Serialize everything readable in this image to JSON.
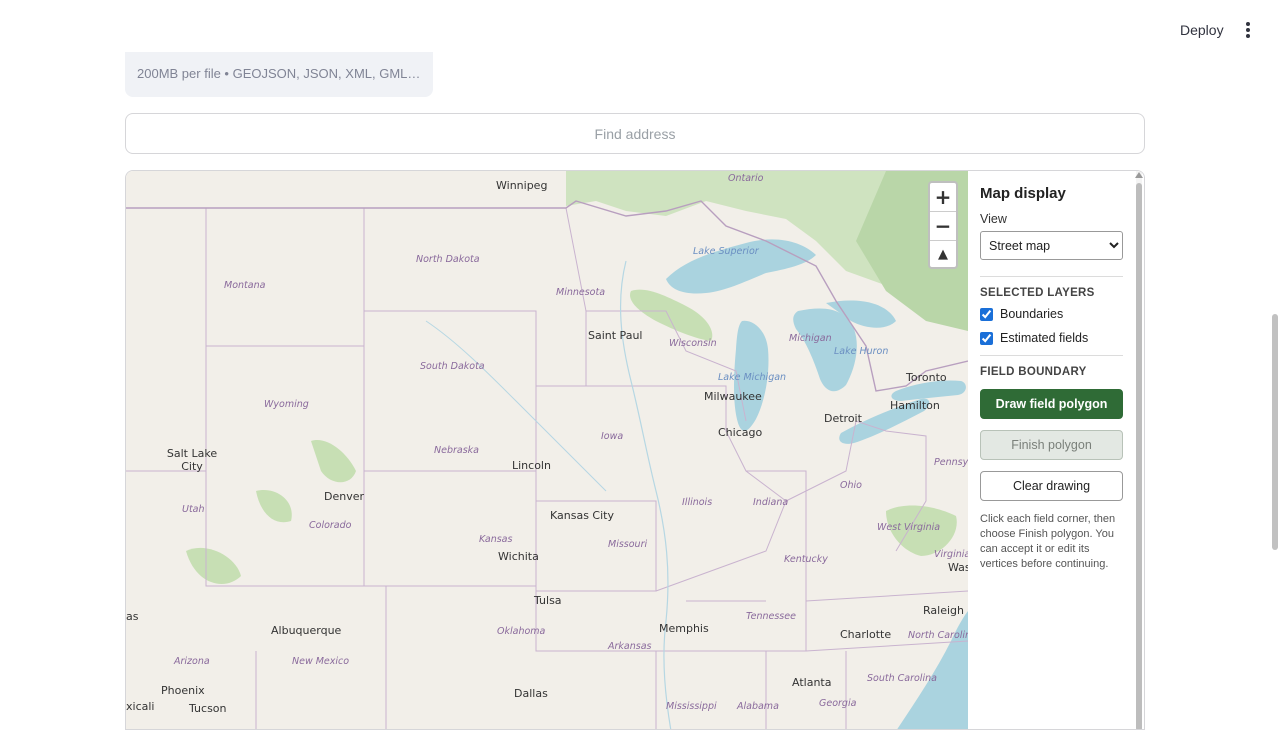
{
  "header": {
    "deploy_label": "Deploy",
    "menu_icon": "kebab-menu-icon"
  },
  "uploader": {
    "note": "200MB per file • GEOJSON, JSON, XML, GML, K…"
  },
  "search": {
    "placeholder": "Find address",
    "value": ""
  },
  "map": {
    "tiles": "OpenStreetMap street map",
    "zoom_in": "+",
    "zoom_out": "−",
    "reset_bearing": "▲",
    "cities": [
      "Winnipeg",
      "Saint Paul",
      "Milwaukee",
      "Chicago",
      "Detroit",
      "Toronto",
      "Hamilton",
      "Salt Lake City",
      "Denver",
      "Lincoln",
      "Kansas City",
      "Wichita",
      "Tulsa",
      "Albuquerque",
      "Memphis",
      "Raleigh",
      "Charlotte",
      "Atlanta",
      "Dallas",
      "Phoenix",
      "Tucson",
      "Was",
      "as",
      "xicali"
    ],
    "states": [
      "Montana",
      "North Dakota",
      "Minnesota",
      "Wisconsin",
      "Michigan",
      "South Dakota",
      "Wyoming",
      "Nebraska",
      "Iowa",
      "Utah",
      "Colorado",
      "Kansas",
      "Missouri",
      "Illinois",
      "Indiana",
      "Ohio",
      "Pennsy",
      "West Virginia",
      "Virginia",
      "Kentucky",
      "Tennessee",
      "Oklahoma",
      "Arkansas",
      "New Mexico",
      "Arizona",
      "North Carolin",
      "South Carolina",
      "Georgia",
      "Alabama",
      "Mississippi",
      "Ontario"
    ],
    "waters": [
      "Lake Superior",
      "Lake Michigan",
      "Lake Huron"
    ]
  },
  "panel": {
    "title": "Map display",
    "view_label": "View",
    "view_selected": "Street map",
    "layers_heading": "SELECTED LAYERS",
    "layers": [
      {
        "label": "Boundaries",
        "checked": true
      },
      {
        "label": "Estimated fields",
        "checked": true
      }
    ],
    "boundary_heading": "FIELD BOUNDARY",
    "draw_button": "Draw field polygon",
    "finish_button": "Finish polygon",
    "clear_button": "Clear drawing",
    "help_text": "Click each field corner, then choose Finish polygon. You can accept it or edit its vertices before continuing."
  },
  "colors": {
    "primary_button": "#2f6b36",
    "map_land": "#f2efe9",
    "water": "#aad3df",
    "forest": "#a9cc95"
  }
}
